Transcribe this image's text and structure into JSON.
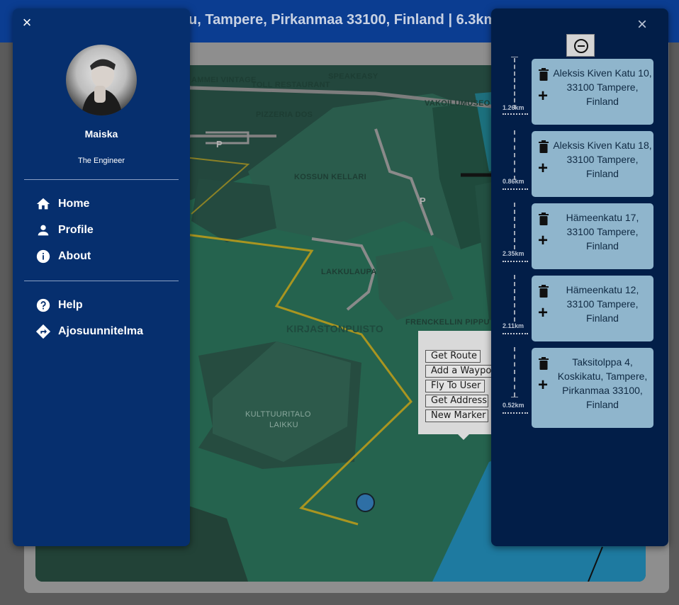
{
  "header": {
    "title": "u, Tampere, Pirkanmaa 33100, Finland | 6.3km"
  },
  "map": {
    "labels": {
      "speakeasy": "SPEAKEASY",
      "restaurant": "TOLL RESTAURANT",
      "vintage": "AMMEI VINTAGE",
      "pizzeria": "PIZZERIA DOS",
      "museo": "VAKOILUMUSEO",
      "pub": "KOSSUN KELLARI",
      "laukulaupa": "LAKKULAUPA",
      "kirjastonpuisto": "KIRJASTONPUISTO",
      "frenckell": "FRENCKELLIN PIPPU",
      "kulttuuritalo": "KULTTUURITALO",
      "laikku": "LAIKKU",
      "parking": "P"
    },
    "popup": {
      "buttons": [
        "Get Route",
        "Add a Waypoint",
        "Fly To User",
        "Get Address",
        "New Marker"
      ]
    }
  },
  "drawer": {
    "close_icon": "×",
    "user_name": "Maiska",
    "user_role": "The Engineer",
    "nav_primary": [
      {
        "label": "Home",
        "icon": "home-icon"
      },
      {
        "label": "Profile",
        "icon": "person-icon"
      },
      {
        "label": "About",
        "icon": "info-icon"
      }
    ],
    "nav_secondary": [
      {
        "label": "Help",
        "icon": "help-icon"
      },
      {
        "label": "Ajosuunnitelma",
        "icon": "directions-icon"
      }
    ]
  },
  "route_panel": {
    "close_icon": "×",
    "waypoints": [
      {
        "address": "Aleksis Kiven Katu 10, 33100 Tampere, Finland",
        "distance": "1.26km"
      },
      {
        "address": "Aleksis Kiven Katu 18, 33100 Tampere, Finland",
        "distance": "0.86km"
      },
      {
        "address": "Hämeenkatu 17, 33100 Tampere, Finland",
        "distance": "2.35km"
      },
      {
        "address": "Hämeenkatu 12, 33100 Tampere, Finland",
        "distance": "2.11km"
      },
      {
        "address": "Taksitolppa 4, Koskikatu, Tampere, Pirkanmaa 33100, Finland",
        "distance": "0.52km"
      }
    ]
  },
  "colors": {
    "app_bar": "#0b3d91",
    "drawer": "#062f6e",
    "route_panel": "#021e48",
    "waypoint_card": "#8fb5cc",
    "map_park": "#25634e",
    "route_line": "#b89a1c"
  }
}
